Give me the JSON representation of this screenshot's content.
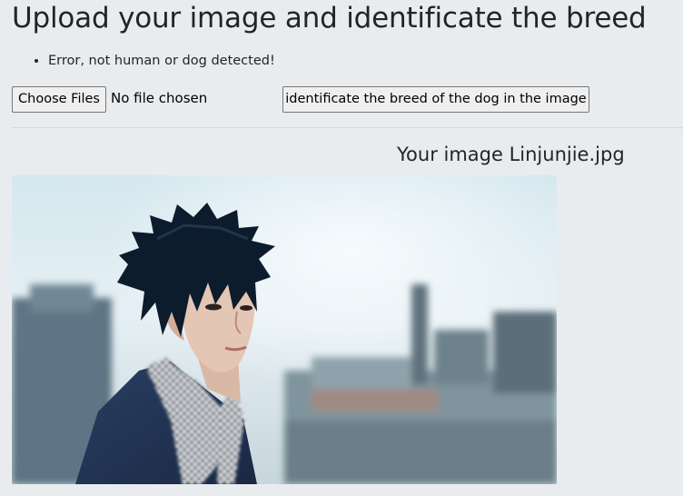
{
  "header": {
    "title": "Upload your image and identificate the breed"
  },
  "messages": [
    "Error, not human or dog detected!"
  ],
  "upload_form": {
    "choose_files_label": "Choose Files",
    "no_file_text": "No file chosen",
    "submit_label": "identificate the breed of the dog in the image"
  },
  "result": {
    "caption": "Your image Linjunjie.jpg",
    "image_alt": "Linjunjie.jpg"
  },
  "colors": {
    "page_background": "#e9ecef",
    "text": "#212529",
    "button_background": "#efefef"
  }
}
